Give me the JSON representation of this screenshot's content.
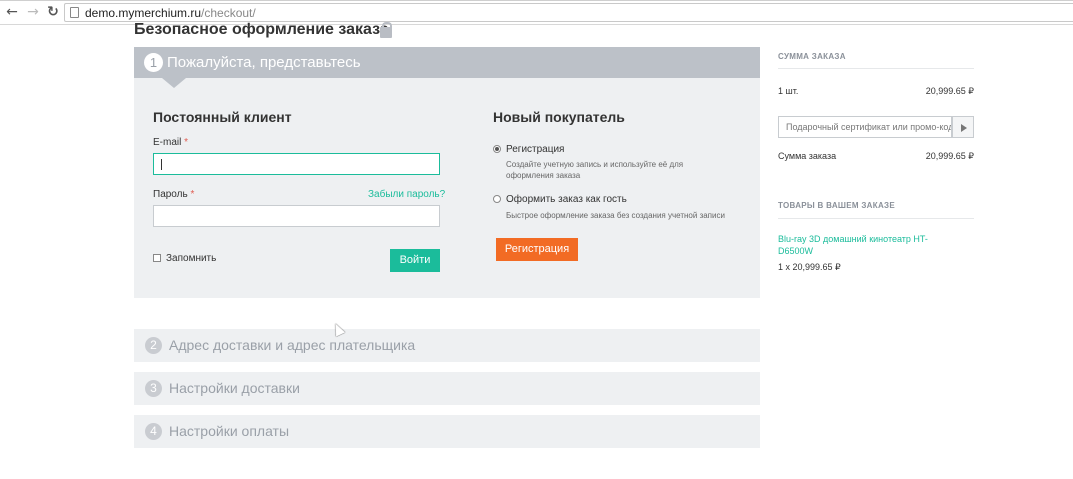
{
  "browser": {
    "url_domain": "demo.mymerchium.ru",
    "url_path": "/checkout/"
  },
  "page": {
    "title": "Безопасное оформление заказа"
  },
  "steps": [
    {
      "number": "1",
      "title": "Пожалуйста, представьтесь",
      "active": true
    },
    {
      "number": "2",
      "title": "Адрес доставки и адрес плательщика",
      "active": false
    },
    {
      "number": "3",
      "title": "Настройки доставки",
      "active": false
    },
    {
      "number": "4",
      "title": "Настройки оплаты",
      "active": false
    }
  ],
  "login": {
    "title": "Постоянный клиент",
    "email_label": "E-mail",
    "email_value": "",
    "password_label": "Пароль",
    "password_value": "",
    "required_mark": "*",
    "forgot_link": "Забыли пароль?",
    "remember_label": "Запомнить",
    "remember_checked": false,
    "login_button": "Войти"
  },
  "new_customer": {
    "title": "Новый покупатель",
    "options": [
      {
        "label": "Регистрация",
        "description": "Создайте учетную запись и используйте её для оформления заказа",
        "selected": true
      },
      {
        "label": "Оформить заказ как гость",
        "description": "Быстрое оформление заказа без создания учетной записи",
        "selected": false
      }
    ],
    "button": "Регистрация"
  },
  "summary": {
    "heading": "СУММА ЗАКАЗА",
    "qty": "1 шт.",
    "qty_amount": "20,999.65 ₽",
    "coupon_placeholder": "Подарочный сертификат или промо-код",
    "total_label": "Сумма заказа",
    "total_amount": "20,999.65 ₽"
  },
  "items": {
    "heading": "ТОВАРЫ В ВАШЕМ ЗАКАЗЕ",
    "list": [
      {
        "name": "Blu-ray 3D домашний кинотеатр HT-D6500W",
        "line": "1 x 20,999.65 ₽"
      }
    ]
  },
  "colors": {
    "accent_green": "#1bbc9b",
    "accent_orange": "#f26b24",
    "step_header": "#bcc1c8",
    "panel_bg": "#eef0f2"
  }
}
